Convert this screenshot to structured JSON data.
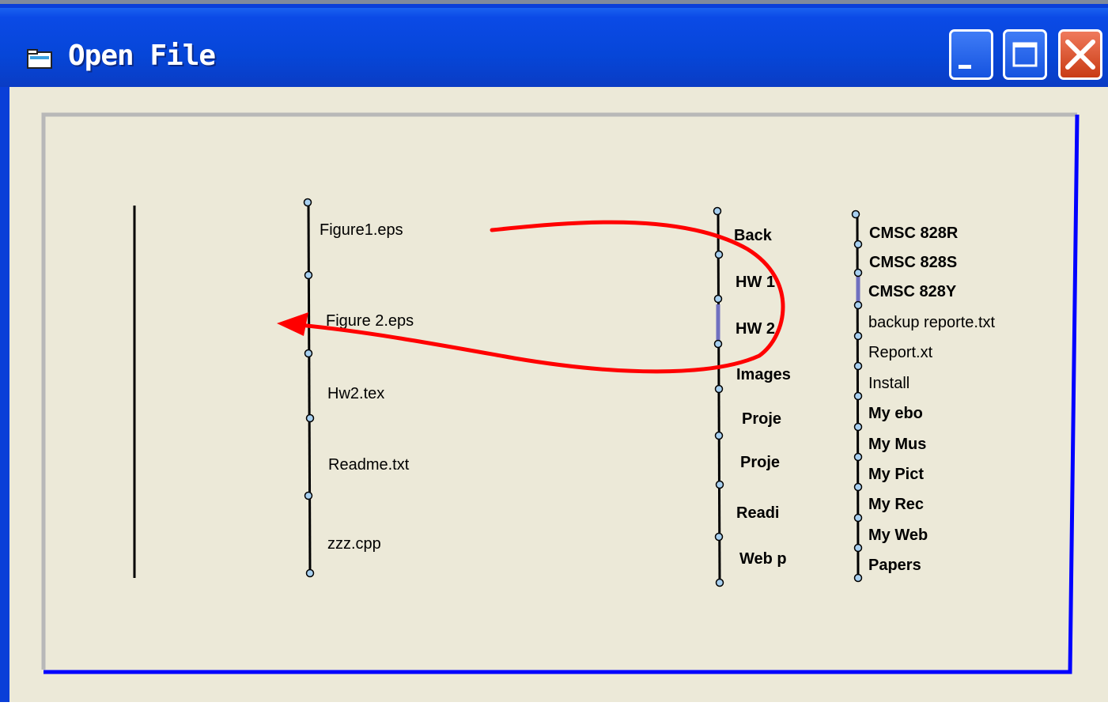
{
  "window": {
    "title": "Open File"
  },
  "titlebar_buttons": {
    "minimize": "minimize-icon",
    "maximize": "maximize-icon",
    "close": "close-icon"
  },
  "column1": {
    "files": [
      "Figure1.eps",
      "Figure 2.eps",
      "Hw2.tex",
      "Readme.txt",
      "zzz.cpp"
    ]
  },
  "column2": {
    "folders": [
      "Back",
      "HW 1",
      "HW 2",
      "Images",
      "Proje",
      "Proje",
      "Readi",
      "Web p"
    ]
  },
  "column3": {
    "items": [
      {
        "label": "CMSC 828R",
        "bold": true
      },
      {
        "label": "CMSC 828S",
        "bold": true
      },
      {
        "label": "CMSC 828Y",
        "bold": true
      },
      {
        "label": "backup reporte.txt",
        "bold": false
      },
      {
        "label": "Report.xt",
        "bold": false
      },
      {
        "label": "Install",
        "bold": false
      },
      {
        "label": "My ebo",
        "bold": true
      },
      {
        "label": "My Mus",
        "bold": true
      },
      {
        "label": "My Pict",
        "bold": true
      },
      {
        "label": "My Rec",
        "bold": true
      },
      {
        "label": "My Web",
        "bold": true
      },
      {
        "label": "Papers",
        "bold": true
      }
    ]
  },
  "colors": {
    "titlebar": "#0a4ae0",
    "window_border": "#0a3fd8",
    "client_bg": "#ece9d8",
    "frame_blue": "#0000ff",
    "frame_gray": "#b8b8b8",
    "node_fill": "#a8d0f0",
    "selection_highlight": "#7070c0",
    "annotation_arrow": "#ff0000"
  }
}
